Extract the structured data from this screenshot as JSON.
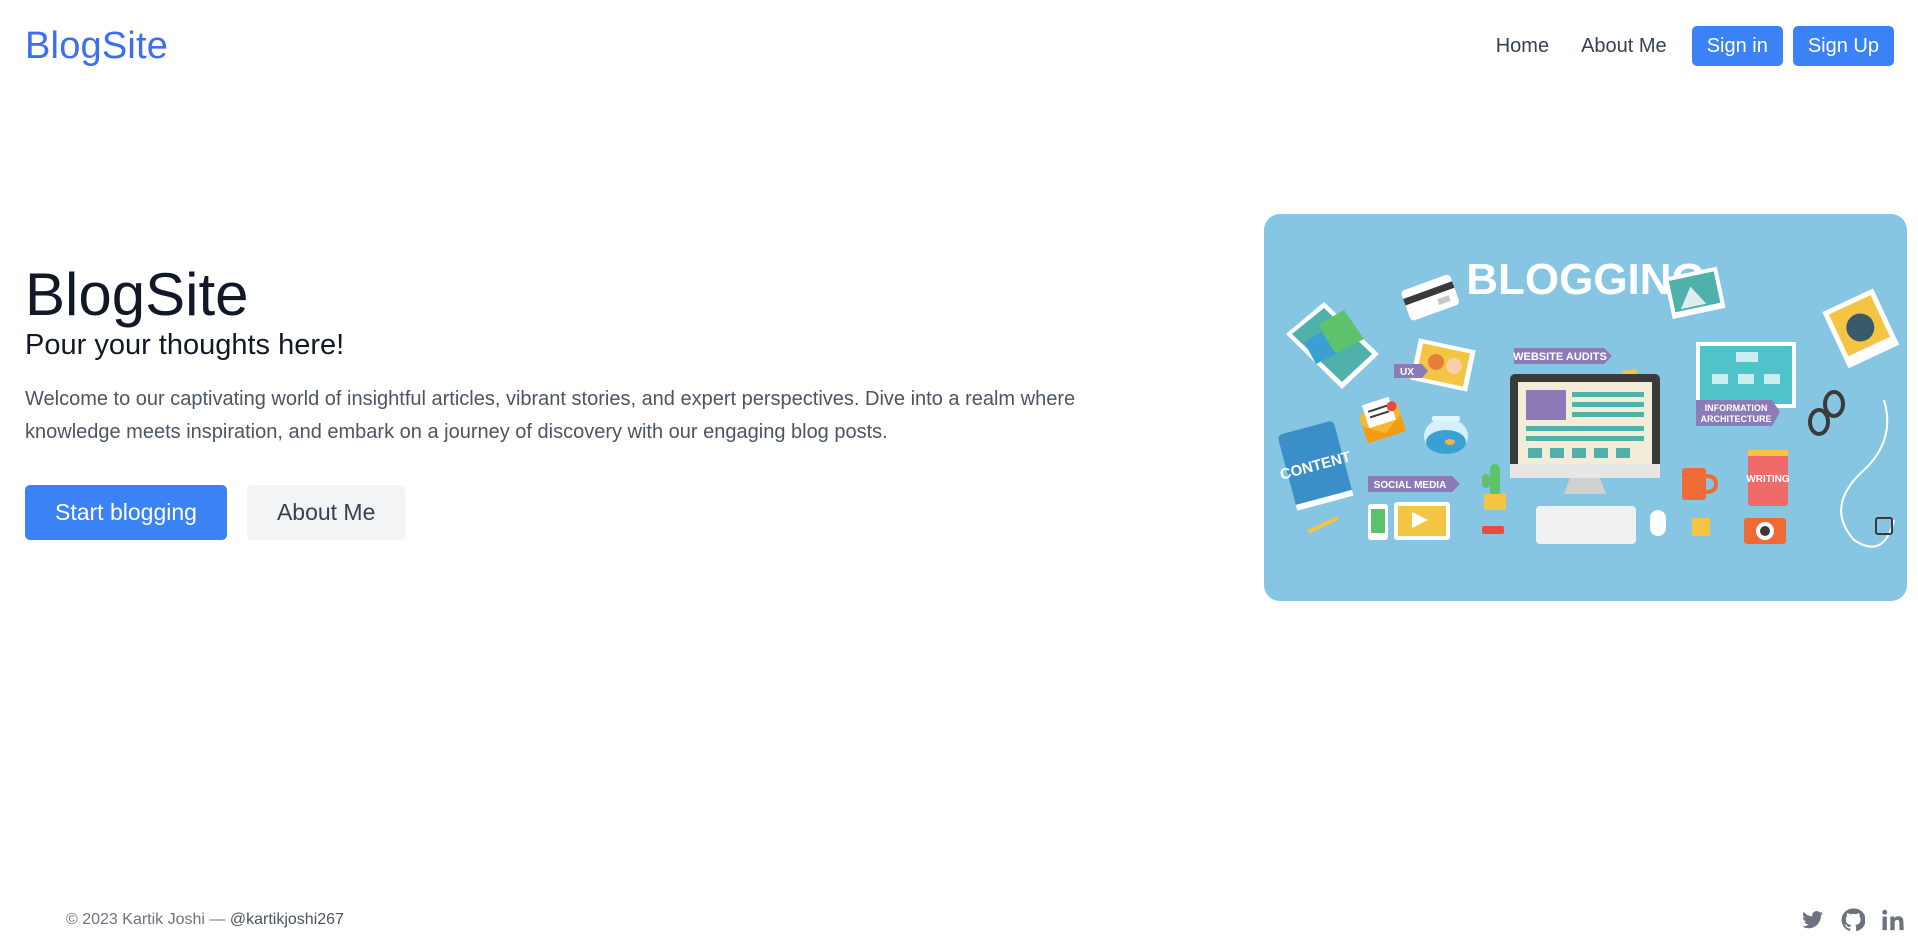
{
  "header": {
    "logo": "BlogSite",
    "nav": [
      {
        "label": "Home"
      },
      {
        "label": "About Me"
      }
    ],
    "sign_in": "Sign in",
    "sign_up": "Sign Up"
  },
  "hero": {
    "title": "BlogSite",
    "subtitle": "Pour your thoughts here!",
    "description": "Welcome to our captivating world of insightful articles, vibrant stories, and expert perspectives. Dive into a realm where knowledge meets inspiration, and embark on a journey of discovery with our engaging blog posts.",
    "primary_cta": "Start blogging",
    "secondary_cta": "About Me"
  },
  "illustration": {
    "headline": "BLOGGING",
    "tags": {
      "ux": "UX",
      "website_audits": "WEBSITE AUDITS",
      "info_arch_line1": "INFORMATION",
      "info_arch_line2": "ARCHITECTURE",
      "content": "CONTENT",
      "social_media": "SOCIAL MEDIA",
      "writing": "WRITING"
    },
    "background_color": "#86c6e3"
  },
  "footer": {
    "copyright": "© 2023 Kartik Joshi —",
    "handle": "@kartikjoshi267",
    "socials": [
      {
        "icon": "twitter-icon"
      },
      {
        "icon": "github-icon"
      },
      {
        "icon": "linkedin-icon"
      }
    ]
  },
  "colors": {
    "accent": "#3b82f6",
    "logo": "#3b6ff0",
    "secondary_button": "#f3f4f6"
  }
}
